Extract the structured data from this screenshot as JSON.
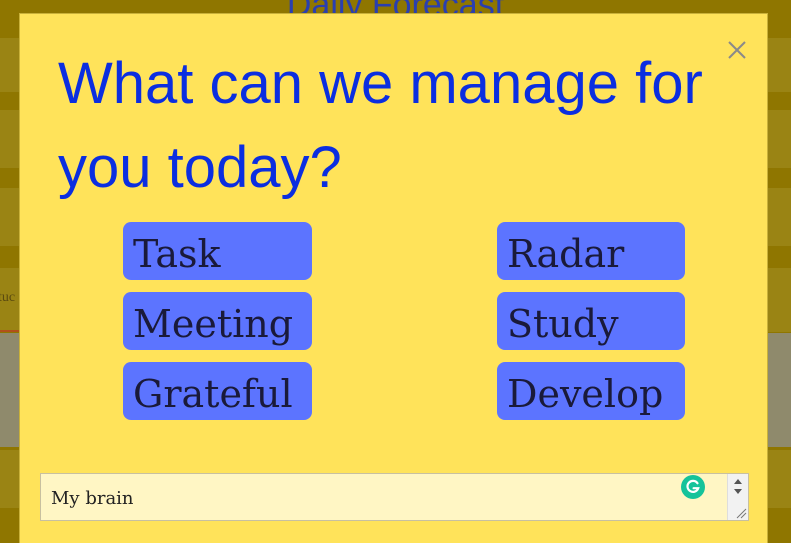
{
  "background": {
    "title": "Daily Forecast",
    "side_text": "tuc"
  },
  "modal": {
    "heading": "What can we manage for you today?",
    "close_icon": "close-icon",
    "categories": [
      {
        "label": "Task"
      },
      {
        "label": "Radar"
      },
      {
        "label": "Meeting"
      },
      {
        "label": "Study"
      },
      {
        "label": "Grateful"
      },
      {
        "label": "Develop"
      }
    ],
    "input": {
      "value": "My brain"
    },
    "grammar_icon": "grammarly-icon"
  },
  "colors": {
    "modal_bg": "#ffe35a",
    "heading": "#0b2ee0",
    "button_bg": "#5c74ff",
    "overlay": "#8f7600"
  }
}
